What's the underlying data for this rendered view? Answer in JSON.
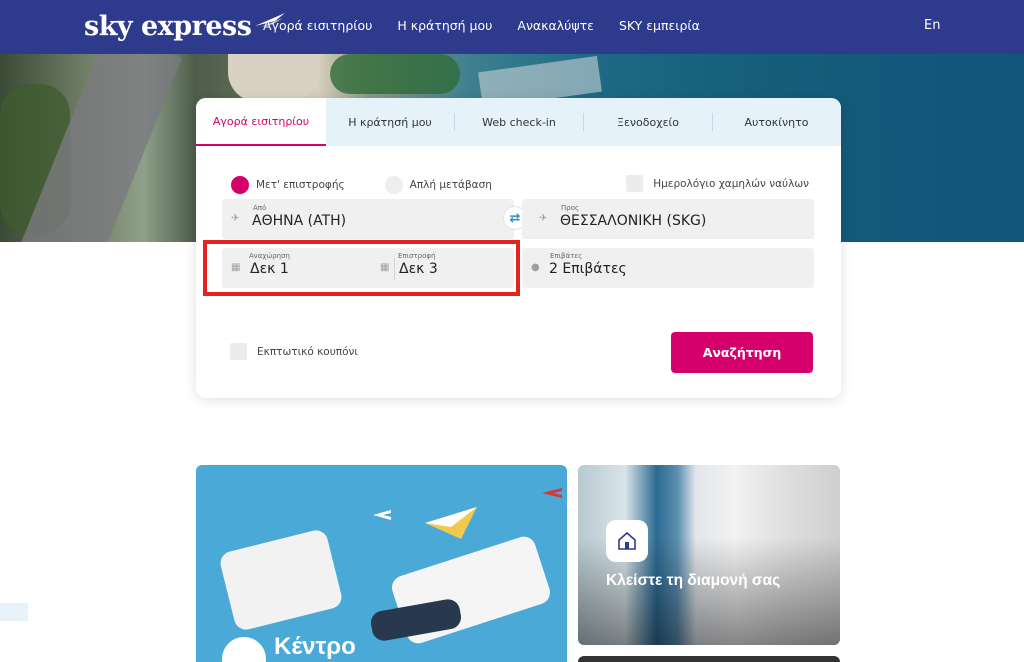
{
  "brand": {
    "name": "sky express"
  },
  "nav": {
    "links": [
      "Αγορά εισιτηρίου",
      "Η κράτησή μου",
      "Ανακαλύψτε",
      "SKY εμπειρία"
    ],
    "lang": "En"
  },
  "booking": {
    "tabs": [
      "Αγορά εισιτηρίου",
      "Η κράτησή μου",
      "Web check-in",
      "Ξενοδοχείο",
      "Αυτοκίνητο"
    ],
    "trip_type": {
      "options": [
        "Μετ' επιστροφής",
        "Απλή μετάβαση"
      ],
      "selected": "Μετ' επιστροφής"
    },
    "fare_calendar_label": "Ημερολόγιο χαμηλών ναύλων",
    "from": {
      "label": "Από",
      "value": "ΑΘΗΝΑ (ATH)"
    },
    "to": {
      "label": "Προς",
      "value": "ΘΕΣΣΑΛΟΝΙΚΗ (SKG)"
    },
    "departure": {
      "label": "Αναχώρηση",
      "value": "Δεκ 1"
    },
    "return": {
      "label": "Επιστροφή",
      "value": "Δεκ 3"
    },
    "passengers": {
      "label": "Επιβάτες",
      "value": "2 Επιβάτες"
    },
    "coupon_label": "Εκπτωτικό κουπόνι",
    "search_label": "Αναζήτηση"
  },
  "promos": {
    "left_title": "Κέντρο",
    "right_title": "Κλείστε τη διαμονή σας"
  },
  "colors": {
    "nav": "#2e3a8c",
    "accent": "#d5006c",
    "highlight": "#e3231f",
    "tabs_bg": "#e5f2fa"
  }
}
